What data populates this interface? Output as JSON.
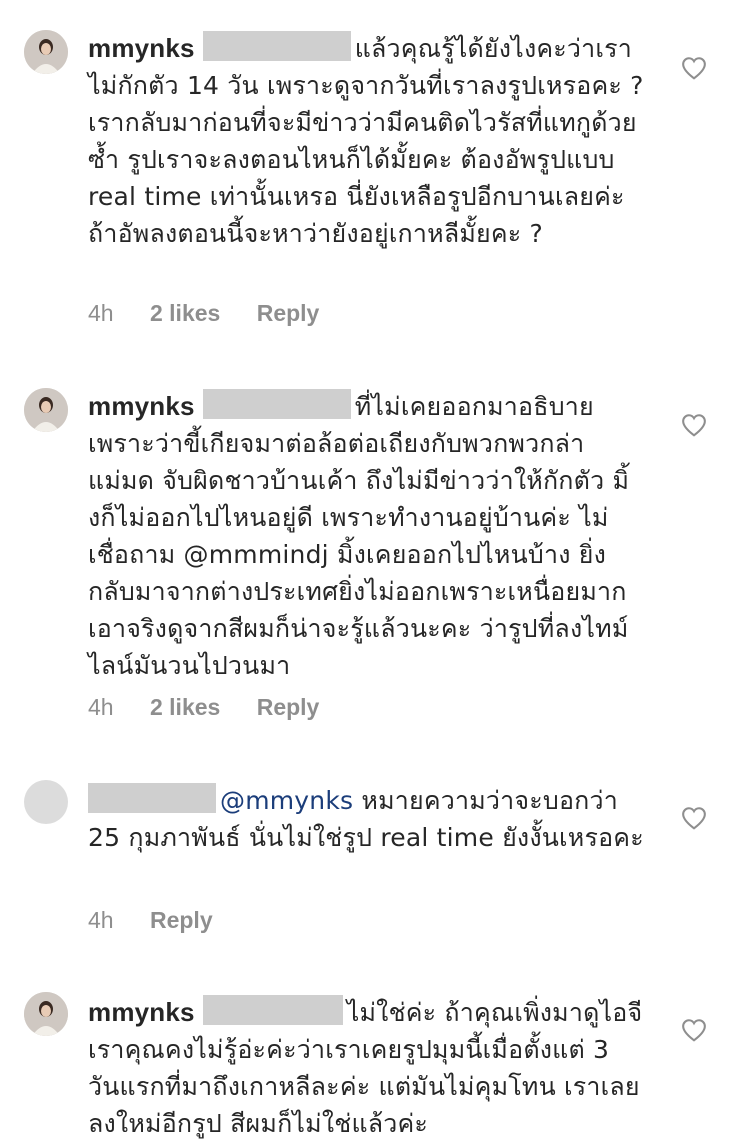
{
  "comments": [
    {
      "username": "mmynks",
      "mention": "",
      "text": "แล้วคุณรู้ได้ยังไงคะว่าเราไม่กักตัว 14 วัน เพราะดูจากวันที่เราลงรูปเหรอคะ ? เรากลับมาก่อนที่จะมีข่าวว่ามีคนติดไวรัสที่แทกูด้วยซ้ำ รูปเราจะลงตอนไหนก็ได้มั้ยคะ ต้องอัพรูปแบบ real time เท่านั้นเหรอ นี่ยังเหลือรูปอีกบานเลยค่ะ ถ้าอัพลงตอนนี้จะหาว่ายังอยู่เกาหลีมั้ยคะ ?",
      "time": "4h",
      "likes": "2 likes",
      "reply": "Reply"
    },
    {
      "username": "mmynks",
      "mention": "",
      "text": "ที่ไม่เคยออกมาอธิบาย เพราะว่าขี้เกียจมาต่อล้อต่อเถียงกับพวกพวกล่าแม่มด จับผิดชาวบ้านเค้า ถึงไม่มีข่าวว่าให้กักตัว มิ้งก็ไม่ออกไปไหนอยู่ดี เพราะทำงานอยู่บ้านค่ะ ไม่เชื่อถาม @mmmindj มิ้งเคยออกไปไหนบ้าง ยิ่งกลับมาจากต่างประเทศยิ่งไม่ออกเพราะเหนื่อยมาก เอาจริงดูจากสีผมก็น่าจะรู้แล้วนะคะ ว่ารูปที่ลงไทม์ไลน์มันวนไปวนมา",
      "time": "4h",
      "likes": "2 likes",
      "reply": "Reply"
    },
    {
      "username": "",
      "mention": "@mmynks",
      "text": "หมายความว่าจะบอกว่า 25 กุมภาพันธ์ นั่นไม่ใช่รูป real time ยังงั้นเหรอคะ",
      "time": "4h",
      "likes": "",
      "reply": "Reply"
    },
    {
      "username": "mmynks",
      "mention": "",
      "text": "ไม่ใช่ค่ะ ถ้าคุณเพิ่งมาดูไอจีเราคุณคงไม่รู้อ่ะค่ะว่าเราเคยรูปมุมนี้เมื่อตั้งแต่ 3 วันแรกที่มาถึงเกาหลีละค่ะ แต่มันไม่คุมโทน เราเลยลงใหม่อีกรูป สีผมก็ไม่ใช่แล้วค่ะ",
      "time": "",
      "likes": "",
      "reply": ""
    }
  ],
  "colors": {
    "text": "#262626",
    "meta": "#8e8e8e",
    "mention": "#1b3d7a",
    "redaction": "#cfcfcf"
  },
  "icons": {
    "like": "heart-outline-icon"
  }
}
